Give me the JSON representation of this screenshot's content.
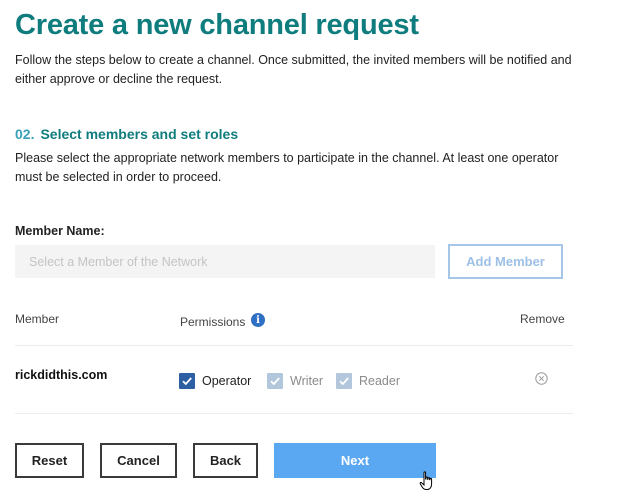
{
  "page": {
    "title": "Create a new channel request",
    "intro": "Follow the steps below to create a channel. Once submitted, the invited members will be notified and either approve or decline the request."
  },
  "step": {
    "number": "02.",
    "title": "Select members and set roles",
    "description": "Please select the appropriate network members to participate in the channel. At least one operator must be selected in order to proceed."
  },
  "member_form": {
    "label": "Member Name:",
    "placeholder": "Select a Member of the Network",
    "value": "",
    "add_button": "Add Member"
  },
  "table": {
    "headers": {
      "member": "Member",
      "permissions": "Permissions",
      "remove": "Remove"
    },
    "rows": [
      {
        "member": "rickdidthis.com",
        "permissions": [
          {
            "label": "Operator",
            "checked": true,
            "enabled": true
          },
          {
            "label": "Writer",
            "checked": true,
            "enabled": false
          },
          {
            "label": "Reader",
            "checked": true,
            "enabled": false
          }
        ]
      }
    ]
  },
  "actions": {
    "reset": "Reset",
    "cancel": "Cancel",
    "back": "Back",
    "next": "Next"
  },
  "colors": {
    "title": "#0f7c7d",
    "step_number": "#3aa0b8",
    "checkbox_active": "#2d5fa3",
    "checkbox_disabled": "#b3c7dc",
    "primary_button": "#5ba8f2",
    "secondary_button_border": "#a6c6e8"
  },
  "icons": {
    "permissions_info": "info-icon",
    "remove": "circle-x-icon",
    "checkbox": "checkmark-icon",
    "cursor": "hand-pointer-icon"
  }
}
